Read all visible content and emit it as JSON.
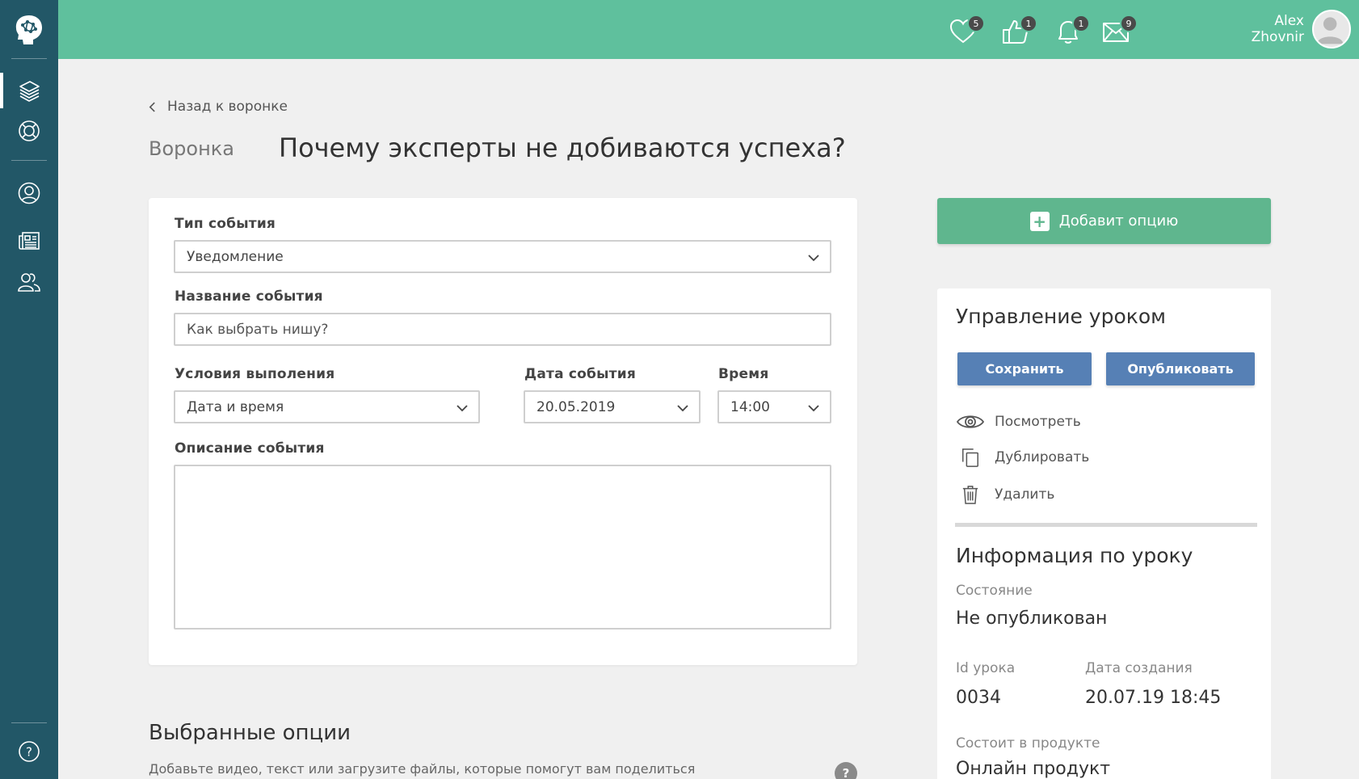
{
  "header": {
    "notifications": [
      {
        "icon": "heart-icon",
        "count": "5"
      },
      {
        "icon": "thumbs-up-icon",
        "count": "1"
      },
      {
        "icon": "bell-icon",
        "count": "1"
      },
      {
        "icon": "mail-icon",
        "count": "9"
      }
    ],
    "user": {
      "first_name": "Alex",
      "last_name": "Zhovnir"
    }
  },
  "sidebar": {
    "items": [
      {
        "icon": "layers-icon",
        "active": true
      },
      {
        "icon": "lifebuoy-icon"
      },
      {
        "icon": "user-icon"
      },
      {
        "icon": "newspaper-icon"
      },
      {
        "icon": "users-icon"
      },
      {
        "icon": "help-icon"
      }
    ]
  },
  "page": {
    "back_label": "Назад к воронке",
    "breadcrumb": "Воронка",
    "title": "Почему эксперты не добиваются успеха?"
  },
  "form": {
    "event_type_label": "Тип события",
    "event_type_value": "Уведомление",
    "event_name_label": "Название события",
    "event_name_placeholder": "Как выбрать нишу?",
    "condition_label": "Условия выполения",
    "condition_value": "Дата и время",
    "date_label": "Дата события",
    "date_value": "20.05.2019",
    "time_label": "Время",
    "time_value": "14:00",
    "description_label": "Описание события"
  },
  "selected_options": {
    "title": "Выбранные опции",
    "description": "Добавьте видео, текст или загрузите файлы, которые помогут вам поделиться",
    "help": "?"
  },
  "side": {
    "add_option_label": "Добавит опцию",
    "manage_title": "Управление уроком",
    "save_label": "Сохранить",
    "publish_label": "Опубликовать",
    "actions": {
      "view": "Посмотреть",
      "duplicate": "Дублировать",
      "delete": "Удалить"
    },
    "info_title": "Информация по уроку",
    "status_label": "Состояние",
    "status_value": "Не опубликован",
    "id_label": "Id урока",
    "id_value": "0034",
    "created_label": "Дата создания",
    "created_value": "20.07.19 18:45",
    "product_label": "Состоит в продукте",
    "product_value": "Онлайн продукт"
  },
  "colors": {
    "header": "#5fc09d",
    "sidebar": "#225767",
    "primary_button": "#5680b5",
    "add_button": "#5fb68e"
  }
}
